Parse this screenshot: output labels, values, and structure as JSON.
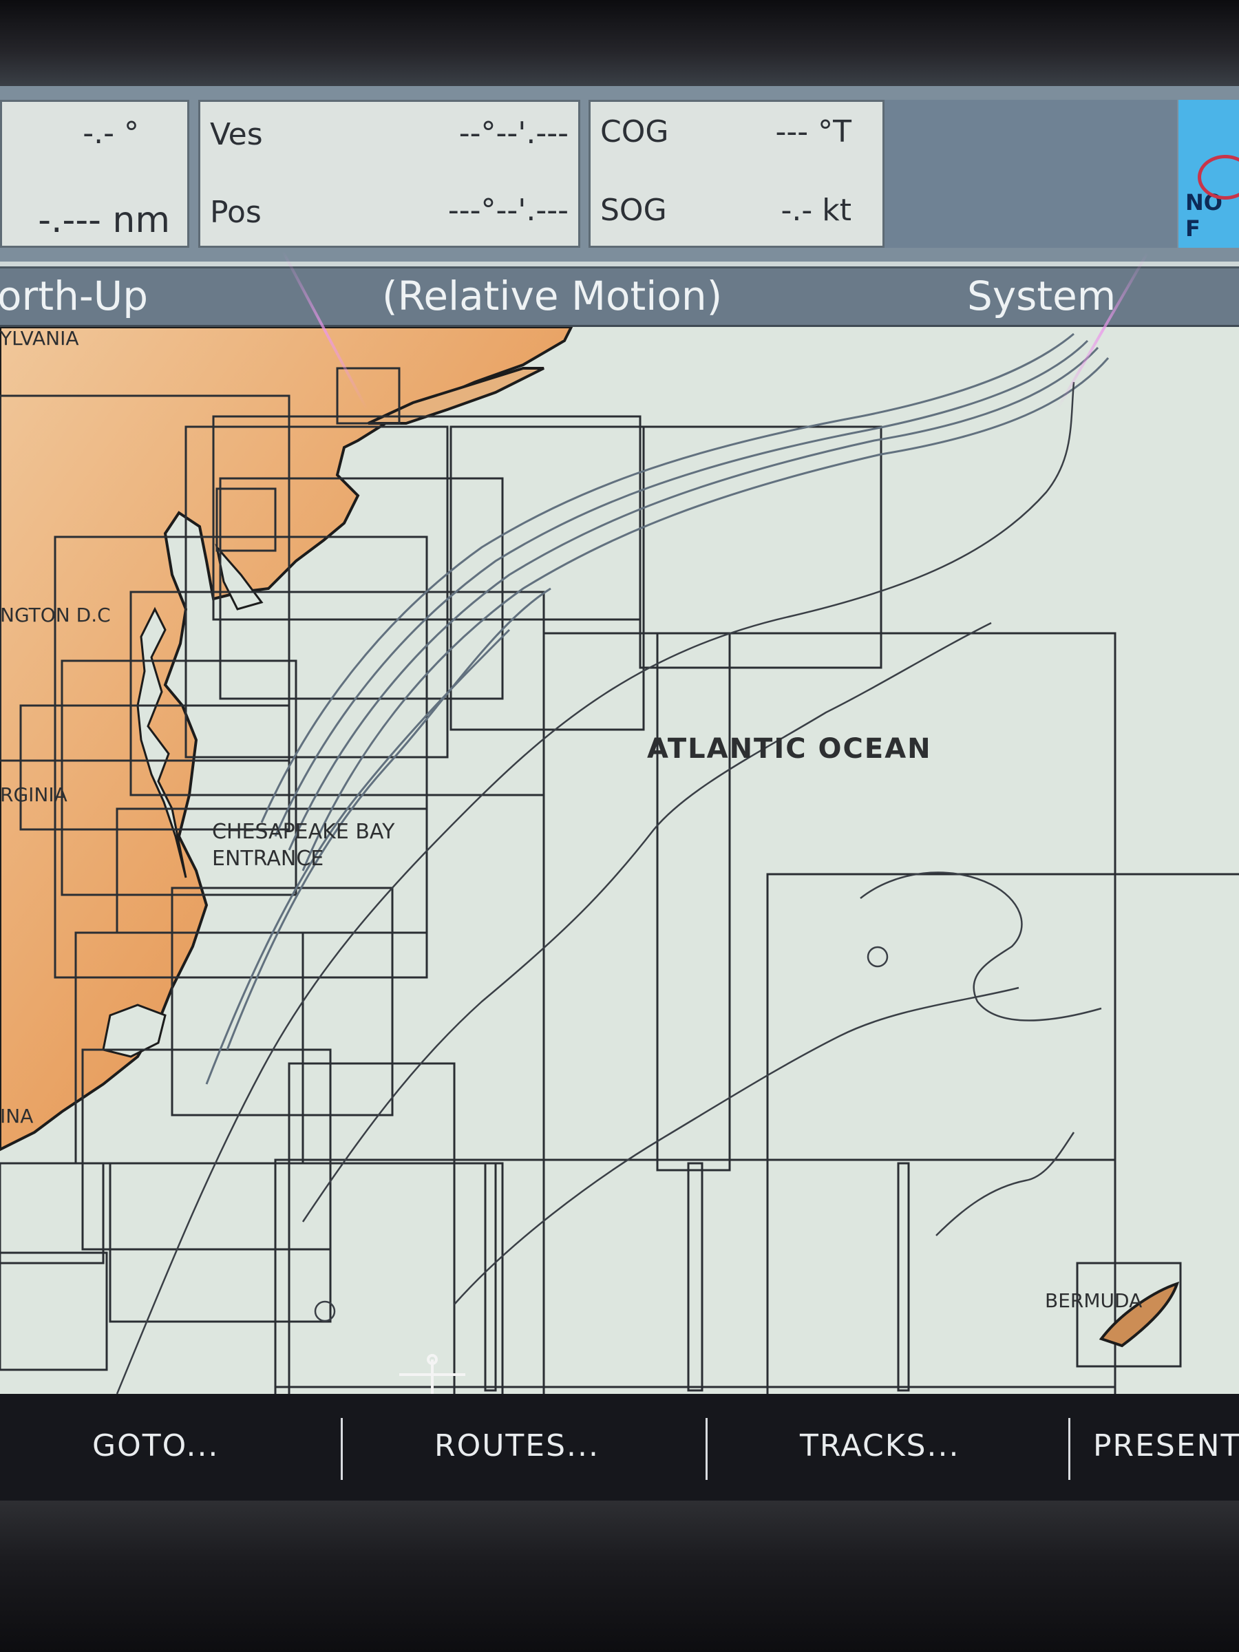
{
  "databar": {
    "box1": {
      "line1": "-.- °",
      "line2": "-.--- nm"
    },
    "box2": {
      "label1": "Ves",
      "value1": "--°--'.---",
      "label2": "Pos",
      "value2": "---°--'.---"
    },
    "box3": {
      "label1": "COG",
      "value1": "--- °T",
      "label2": "SOG",
      "value2": "-.- kt"
    },
    "logo_text": "NO F"
  },
  "status": {
    "orientation": "orth-Up",
    "motion": "(Relative Motion)",
    "mode": "System"
  },
  "map": {
    "labels": {
      "pennsylvania": "YLVANIA",
      "washington": "NGTON D.C",
      "virginia": "RGINIA",
      "chesapeake1": "CHESAPEAKE BAY",
      "chesapeake2": "ENTRANCE",
      "carolina": "INA",
      "atlantic": "ATLANTIC OCEAN",
      "bermuda": "BERMUDA"
    }
  },
  "softkeys": [
    "GOTO...",
    "ROUTES...",
    "TRACKS...",
    "PRESENT"
  ],
  "colors": {
    "land": "#e79a5a",
    "sea": "#dde6df",
    "chart_outline": "#2a2e33",
    "depth_contour": "#62717f"
  }
}
